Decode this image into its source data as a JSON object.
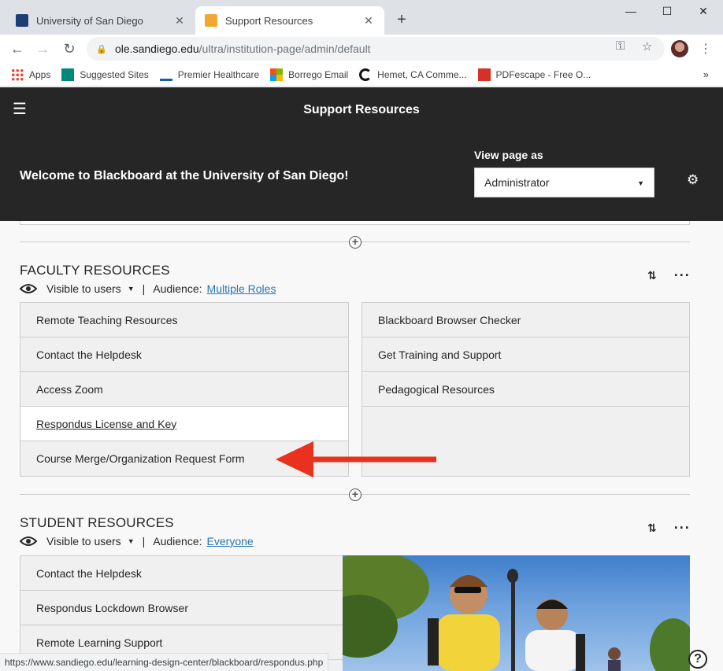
{
  "browser": {
    "tabs": [
      {
        "title": "University of San Diego",
        "close": "✕",
        "active": false
      },
      {
        "title": "Support Resources",
        "close": "✕",
        "active": true
      }
    ],
    "new_tab": "+",
    "window_controls": {
      "minimize": "—",
      "maximize": "☐",
      "close": "✕"
    },
    "nav": {
      "back": "←",
      "forward": "→",
      "reload": "↻"
    },
    "url_host": "ole.sandiego.edu",
    "url_path": "/ultra/institution-page/admin/default",
    "bookmarks": [
      {
        "label": "Apps",
        "icon": "apps-grid-icon"
      },
      {
        "label": "Suggested Sites",
        "icon": "bing-icon"
      },
      {
        "label": "Premier Healthcare",
        "icon": "phm-icon"
      },
      {
        "label": "Borrego Email",
        "icon": "microsoft-icon"
      },
      {
        "label": "Hemet, CA Comme...",
        "icon": "c-logo-icon"
      },
      {
        "label": "PDFescape - Free O...",
        "icon": "pdf-icon"
      }
    ],
    "bookmarks_more": "»",
    "status_url": "https://www.sandiego.edu/learning-design-center/blackboard/respondus.php"
  },
  "page": {
    "title": "Support Resources",
    "welcome": "Welcome to Blackboard at the University of San Diego!",
    "view_as_label": "View page as",
    "view_as_value": "Administrator"
  },
  "sections": [
    {
      "title": "FACULTY RESOURCES",
      "visibility": "Visible to users",
      "audience_label": "Audience:",
      "audience_value": "Multiple Roles",
      "left_links": [
        "Remote Teaching Resources",
        "Contact the Helpdesk",
        "Access Zoom",
        "Respondus License and Key",
        "Course Merge/Organization Request Form"
      ],
      "right_links": [
        "Blackboard Browser Checker",
        "Get Training and Support",
        "Pedagogical Resources"
      ]
    },
    {
      "title": "STUDENT RESOURCES",
      "visibility": "Visible to users",
      "audience_label": "Audience:",
      "audience_value": "Everyone",
      "left_links": [
        "Contact the Helpdesk",
        "Respondus Lockdown Browser",
        "Remote Learning Support"
      ]
    }
  ],
  "colors": {
    "header_bg": "#262626",
    "link": "#2775b5",
    "arrow": "#e8321e"
  }
}
